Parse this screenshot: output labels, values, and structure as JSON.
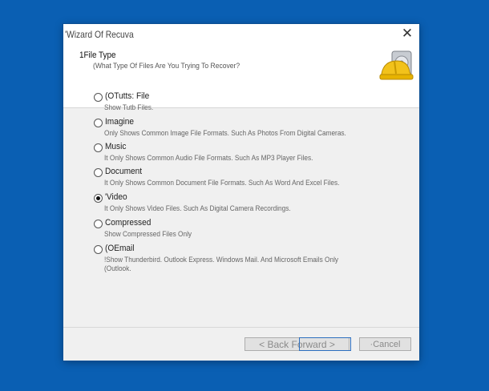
{
  "window": {
    "title": "'Wizard Of Recuva",
    "close_glyph": "✕"
  },
  "header": {
    "title": "1File Type",
    "subtitle": "(What Type Of Files Are You Trying To Recover?",
    "icon": "recuva-hardhat-hdd-icon"
  },
  "options": [
    {
      "label": "(OTutts: File",
      "description": "Show Tutb Files.",
      "selected": false
    },
    {
      "label": "Imagine",
      "description": "Only Shows Common Image File Formats. Such As Photos From Digital Cameras.",
      "selected": false
    },
    {
      "label": "Music",
      "description": "It Only Shows Common Audio File Formats. Such As MP3 Player Files.",
      "selected": false
    },
    {
      "label": "Document",
      "description": "It Only Shows Common Document File Formats. Such As Word And Excel Files.",
      "selected": false
    },
    {
      "label": "'Video",
      "description": "It Only Shows Video Files. Such As Digital Camera Recordings.",
      "selected": true
    },
    {
      "label": "Compressed",
      "description": "Show Compressed Files Only",
      "selected": false
    },
    {
      "label": "(OEmail",
      "description": "!Show Thunderbird. Outlook Express. Windows Mail. And Microsoft Emails Only",
      "description_line2": "(Outlook.",
      "selected": false
    }
  ],
  "buttons": {
    "navigation": "< Back Forward >",
    "cancel": "·Cancel"
  }
}
